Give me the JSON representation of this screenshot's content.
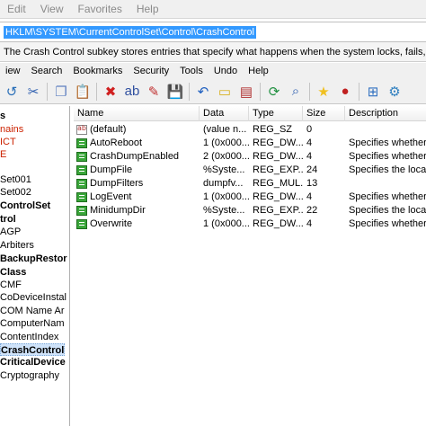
{
  "top_menu": {
    "items": [
      "Edit",
      "View",
      "Favorites",
      "Help"
    ]
  },
  "address": {
    "path": "HKLM\\SYSTEM\\CurrentControlSet\\Control\\CrashControl"
  },
  "description": {
    "text": "The Crash Control subkey stores entries that specify what happens when the system locks, fails, or terminate"
  },
  "menubar": {
    "items": [
      "iew",
      "Search",
      "Bookmarks",
      "Security",
      "Tools",
      "Undo",
      "Help"
    ]
  },
  "toolbar": {
    "buttons": [
      {
        "name": "back-icon",
        "glyph": "↺",
        "color": "#2a6fb8"
      },
      {
        "name": "cut-icon",
        "glyph": "✂",
        "color": "#3060b0"
      },
      {
        "name": "copy-icon",
        "glyph": "❐",
        "color": "#6080c0"
      },
      {
        "name": "paste-icon",
        "glyph": "📋",
        "color": "#806040"
      },
      {
        "name": "delete-icon",
        "glyph": "✖",
        "color": "#d02020"
      },
      {
        "name": "rename-icon",
        "glyph": "ab",
        "color": "#3050a0"
      },
      {
        "name": "edit-value-icon",
        "glyph": "✎",
        "color": "#c03030"
      },
      {
        "name": "save-icon",
        "glyph": "💾",
        "color": "#304080"
      },
      {
        "name": "undo-icon",
        "glyph": "↶",
        "color": "#2060c0"
      },
      {
        "name": "new-key-icon",
        "glyph": "▭",
        "color": "#d8b020"
      },
      {
        "name": "export-icon",
        "glyph": "▤",
        "color": "#b03030"
      },
      {
        "name": "refresh-icon",
        "glyph": "⟳",
        "color": "#209040"
      },
      {
        "name": "search-icon",
        "glyph": "⌕",
        "color": "#3060b0"
      },
      {
        "name": "favorite-star-icon",
        "glyph": "★",
        "color": "#f0c020"
      },
      {
        "name": "bookmark-icon",
        "glyph": "●",
        "color": "#c02020"
      },
      {
        "name": "network-icon",
        "glyph": "⊞",
        "color": "#3070c0"
      },
      {
        "name": "tools-icon",
        "glyph": "⚙",
        "color": "#3080c0"
      }
    ]
  },
  "tree": {
    "items": [
      {
        "label": "s",
        "style": "bold"
      },
      {
        "label": "nains",
        "style": "red"
      },
      {
        "label": "ICT",
        "style": "red"
      },
      {
        "label": "E",
        "style": "red"
      },
      {
        "label": "",
        "style": ""
      },
      {
        "label": "Set001",
        "style": ""
      },
      {
        "label": "Set002",
        "style": ""
      },
      {
        "label": "ControlSet",
        "style": "bold"
      },
      {
        "label": "trol",
        "style": "bold"
      },
      {
        "label": "AGP",
        "style": ""
      },
      {
        "label": "Arbiters",
        "style": ""
      },
      {
        "label": "BackupRestor",
        "style": "bold"
      },
      {
        "label": "Class",
        "style": "bold"
      },
      {
        "label": "CMF",
        "style": ""
      },
      {
        "label": "CoDeviceInstal",
        "style": ""
      },
      {
        "label": "COM Name Ar",
        "style": ""
      },
      {
        "label": "ComputerNam",
        "style": ""
      },
      {
        "label": "ContentIndex",
        "style": ""
      },
      {
        "label": "CrashControl",
        "style": "sel"
      },
      {
        "label": "CriticalDevice",
        "style": "bold"
      },
      {
        "label": "Cryptography",
        "style": ""
      }
    ]
  },
  "list": {
    "columns": [
      "Name",
      "Data",
      "Type",
      "Size",
      "Description"
    ],
    "rows": [
      {
        "icon": "str",
        "name": "(default)",
        "data": "(value n...",
        "type": "REG_SZ",
        "size": "0",
        "desc": ""
      },
      {
        "icon": "dword",
        "name": "AutoReboot",
        "data": "1  (0x000...",
        "type": "REG_DW...",
        "size": "4",
        "desc": "Specifies whether the"
      },
      {
        "icon": "dword",
        "name": "CrashDumpEnabled",
        "data": "2  (0x000...",
        "type": "REG_DW...",
        "size": "4",
        "desc": "Specifies whether Wi"
      },
      {
        "icon": "dword",
        "name": "DumpFile",
        "data": "%Syste...",
        "type": "REG_EXP...",
        "size": "24",
        "desc": "Specifies the location"
      },
      {
        "icon": "dword",
        "name": "DumpFilters",
        "data": "dumpfv...",
        "type": "REG_MUL...",
        "size": "13",
        "desc": ""
      },
      {
        "icon": "dword",
        "name": "LogEvent",
        "data": "1  (0x000...",
        "type": "REG_DW...",
        "size": "4",
        "desc": "Specifies whether the"
      },
      {
        "icon": "dword",
        "name": "MinidumpDir",
        "data": "%Syste...",
        "type": "REG_EXP...",
        "size": "22",
        "desc": "Specifies the location"
      },
      {
        "icon": "dword",
        "name": "Overwrite",
        "data": "1  (0x000...",
        "type": "REG_DW...",
        "size": "4",
        "desc": "Specifies whether the"
      }
    ]
  }
}
